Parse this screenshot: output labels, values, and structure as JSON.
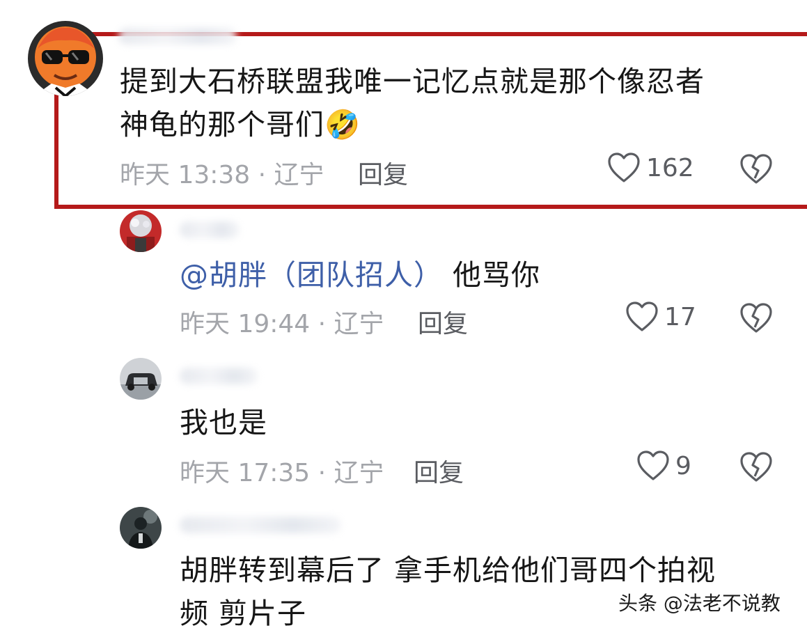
{
  "comments": [
    {
      "text_line1": "提到大石桥联盟我唯一记忆点就是那个像忍者",
      "text_line2": "神龟的那个哥们",
      "emoji": "🤣",
      "meta": "昨天 13:38 · 辽宁",
      "reply_label": "回复",
      "likes": "162"
    },
    {
      "mention": "@胡胖（团队招人）",
      "text": "他骂你",
      "meta": "昨天 19:44 · 辽宁",
      "reply_label": "回复",
      "likes": "17"
    },
    {
      "text": "我也是",
      "meta": "昨天 17:35 · 辽宁",
      "reply_label": "回复",
      "likes": "9"
    },
    {
      "text_line1": "胡胖转到幕后了 拿手机给他们哥四个拍视",
      "text_line2": "频 剪片子"
    }
  ],
  "watermark": "头条 @法老不说教",
  "icons": {
    "like": "heart-outline-icon",
    "dislike": "broken-heart-icon"
  },
  "colors": {
    "highlight": "#b51a1a",
    "mention": "#3e5fa8",
    "meta": "#a3a5aa"
  }
}
